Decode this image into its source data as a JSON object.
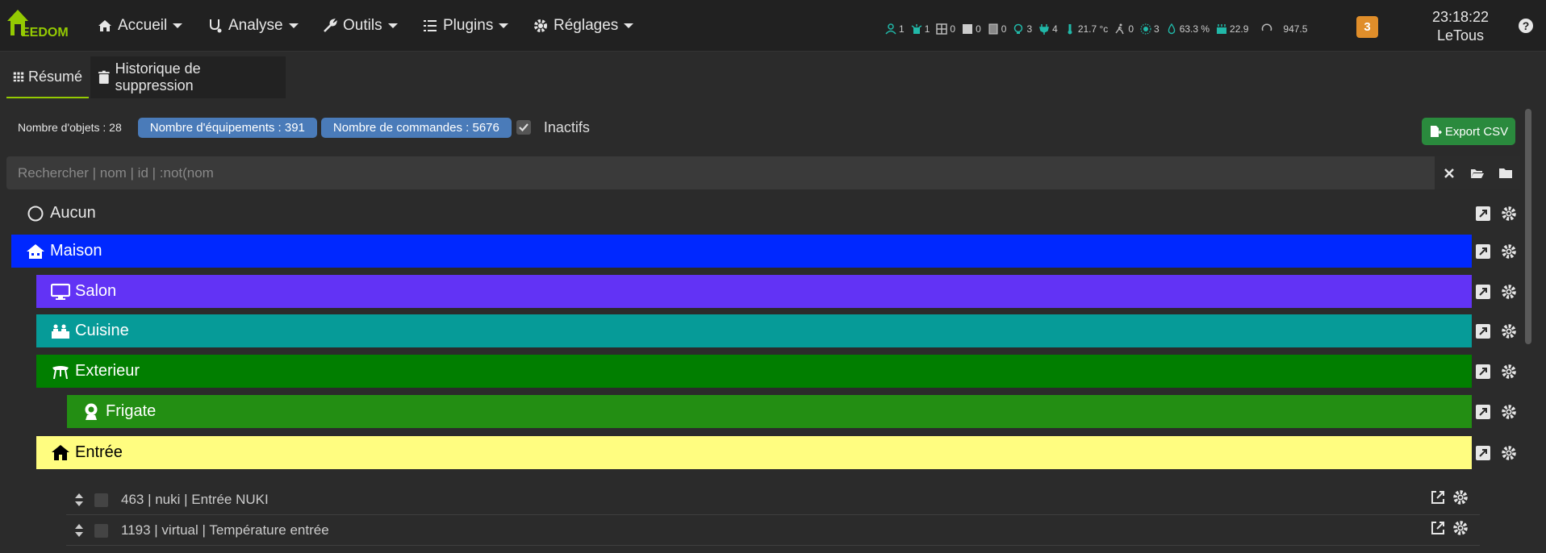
{
  "app": {
    "logo_text": "EEDOM"
  },
  "nav": [
    {
      "label": "Accueil",
      "icon": "home-icon"
    },
    {
      "label": "Analyse",
      "icon": "stethoscope-icon"
    },
    {
      "label": "Outils",
      "icon": "wrench-icon"
    },
    {
      "label": "Plugins",
      "icon": "list-check-icon"
    },
    {
      "label": "Réglages",
      "icon": "gear-icon"
    }
  ],
  "summary": [
    {
      "icon": "person-icon",
      "value": "1"
    },
    {
      "icon": "alarm-icon",
      "value": "1"
    },
    {
      "icon": "window-icon",
      "value": "0"
    },
    {
      "icon": "shutter-icon",
      "value": "0"
    },
    {
      "icon": "door-icon",
      "value": "0"
    },
    {
      "icon": "bulb-icon",
      "value": "3"
    },
    {
      "icon": "plug-icon",
      "value": "4"
    },
    {
      "icon": "thermometer-icon",
      "value": "21.7 °c"
    },
    {
      "icon": "motion-icon",
      "value": "0"
    },
    {
      "icon": "sun-icon",
      "value": "3"
    },
    {
      "icon": "humidity-icon",
      "value": "63.3 %"
    },
    {
      "icon": "heater-icon",
      "value": "22.9"
    },
    {
      "icon": "pressure-icon",
      "value": "947.5"
    }
  ],
  "notifications": "3",
  "clock": {
    "time": "23:18:22",
    "profile": "LeTous"
  },
  "tabs": [
    {
      "label": "Résumé",
      "icon": "grid-icon"
    },
    {
      "label": "Historique de suppression",
      "icon": "trash-icon"
    }
  ],
  "counts": {
    "objects": "Nombre d'objets : 28",
    "equipments": "Nombre d'équipements : 391",
    "commands": "Nombre de commandes : 5676",
    "inactive_label": "Inactifs"
  },
  "export_label": "Export CSV",
  "search": {
    "placeholder": "Rechercher | nom | id | :not(nom"
  },
  "objects": [
    {
      "name": "Aucun",
      "icon": "circle-icon",
      "color": "#2b2b2b",
      "text_color": "#e6e6e6"
    },
    {
      "name": "Maison",
      "icon": "house-icon",
      "color": "#0028ff",
      "text_color": "#ffffff"
    },
    {
      "name": "Salon",
      "icon": "tv-icon",
      "color": "#6233f5",
      "text_color": "#ffffff"
    },
    {
      "name": "Cuisine",
      "icon": "kitchen-icon",
      "color": "#069b98",
      "text_color": "#ffffff"
    },
    {
      "name": "Exterieur",
      "icon": "bbq-icon",
      "color": "#017e00",
      "text_color": "#ffffff"
    },
    {
      "name": "Frigate",
      "icon": "camera-icon",
      "color": "#238e13",
      "text_color": "#ffffff"
    },
    {
      "name": "Entrée",
      "icon": "home-door-icon",
      "color": "#fffd80",
      "text_color": "#000000"
    }
  ],
  "equipments": [
    {
      "label": "463 | nuki | Entrée NUKI"
    },
    {
      "label": "1193 | virtual | Température entrée"
    }
  ]
}
